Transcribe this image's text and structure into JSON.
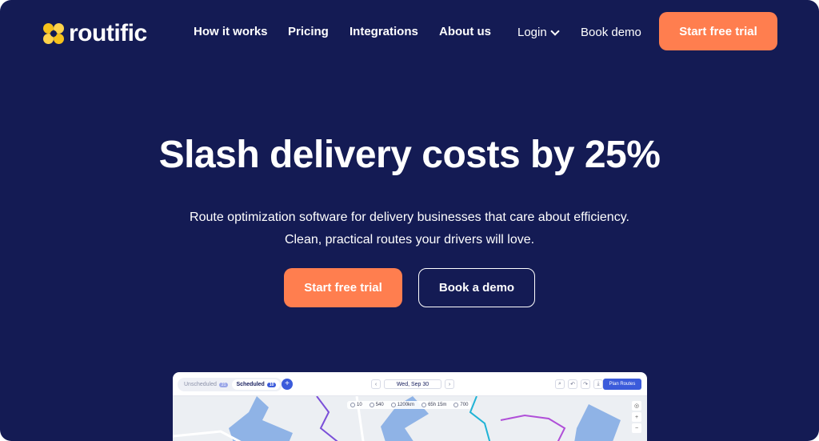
{
  "brand": {
    "name": "routific"
  },
  "nav": {
    "items": [
      {
        "label": "How it works"
      },
      {
        "label": "Pricing"
      },
      {
        "label": "Integrations"
      },
      {
        "label": "About us"
      }
    ],
    "login_label": "Login",
    "book_demo_label": "Book demo",
    "cta_label": "Start free trial"
  },
  "hero": {
    "title": "Slash delivery costs by 25%",
    "subtitle_line1": "Route optimization software for delivery businesses that care about efficiency.",
    "subtitle_line2": "Clean, practical routes your drivers will love.",
    "primary_cta": "Start free trial",
    "secondary_cta": "Book a demo"
  },
  "preview": {
    "tabs": [
      {
        "label": "Unscheduled",
        "count": "21"
      },
      {
        "label": "Scheduled",
        "count": "10"
      }
    ],
    "add_icon": "+",
    "date": "Wed, Sep 30",
    "prev_icon": "‹",
    "next_icon": "›",
    "tool_icons": [
      "search-icon",
      "undo-icon",
      "redo-icon",
      "download-icon"
    ],
    "plan_button": "Plan Routes",
    "stats": [
      {
        "icon": "route-icon",
        "value": "10"
      },
      {
        "icon": "stops-icon",
        "value": "540"
      },
      {
        "icon": "distance-icon",
        "value": "1200km"
      },
      {
        "icon": "clock-icon",
        "value": "65h 15m"
      },
      {
        "icon": "capacity-icon",
        "value": "700"
      }
    ],
    "map_controls": [
      "layers-icon",
      "zoom-in-icon",
      "zoom-out-icon"
    ]
  },
  "colors": {
    "background": "#141b54",
    "accent": "#ff7e4f",
    "preview_primary": "#3b5bdb"
  }
}
